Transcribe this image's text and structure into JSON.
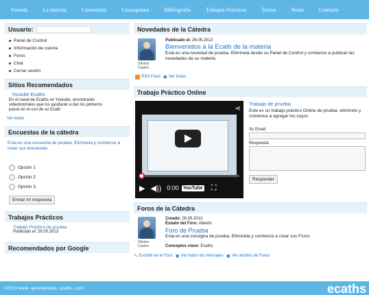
{
  "nav": {
    "items": [
      "Portada",
      "La materia",
      "Contenidos",
      "Cronograma",
      "Bibliografía",
      "Trabajos Prácticos",
      "Textos",
      "Notas",
      "Contacto"
    ]
  },
  "user": {
    "title": "Usuario:",
    "menu": [
      "Panel de Control",
      "Información de cuenta",
      "Foros",
      "Chat",
      "Cerrar sesión"
    ]
  },
  "recommended": {
    "title": "Sitios Recomendados",
    "item_title": "Youtube Ecaths",
    "item_desc": "En el canal de Ecaths en Youtube, encontrarán videotutoriales que los ayudarán a dar los primeros pasos en el uso de su Ecath",
    "more": "Ver todos"
  },
  "poll": {
    "title": "Encuestas de la cátedra",
    "question": "Esta es una encuesta de prueba. Elimínela y comience a crear sus encuestas",
    "options": [
      "Opción 1",
      "Opción 2",
      "Opción 3"
    ],
    "send": "Enviar mi respuesta"
  },
  "practicos": {
    "title": "Trabajos Prácticos",
    "item_title": "Trabajo Práctico de prueba",
    "item_date": "Publicado el: 26.05.2013"
  },
  "google": {
    "title": "Recomendados por Google"
  },
  "news": {
    "title": "Novedades de la Cátedra",
    "published_label": "Publicado el:",
    "published_date": "26.05.2013",
    "headline": "Bienvenidos a la Ecath de la materia",
    "text": "Esta es una novedad de prueba. Elimínela desde su Panel de Control y comience a publicar las novedades de su materia",
    "author": "Silvina Castro",
    "rss": "RSS Feed",
    "see_all": "Ver todas"
  },
  "tpo": {
    "title": "Trabajo Práctico Online",
    "video_time": "0:00",
    "video_logo": "YouTube",
    "progress": 0.03,
    "item_title": "Trabajo de prueba",
    "item_text": "Este es un trabajo práctico Online de prueba, elimínelo y comience a agregar los suyos",
    "email_label": "Su Email",
    "answer_label": "Respuesta",
    "submit": "Responder"
  },
  "forum": {
    "title": "Foros de la Cátedra",
    "created_label": "Creado:",
    "created_date": "26.05.2013",
    "state_label": "Estado del Foro:",
    "state": "Abierto",
    "headline": "Foro de Prueba",
    "text": "Esta es una consigna de prueba. Elimínela y comience a crear sus Foros",
    "tags_label": "Conceptos clave:",
    "tags": "Ecaths",
    "author": "Silvina Castro",
    "write": "Escribir en el Foro",
    "see_messages": "Ver todos los mensajes",
    "archive": "Ver archivo de Foros"
  },
  "footer": {
    "copyright": "©2013 www. aprendeiastic. ecaths. com",
    "brand_e": "e",
    "brand_rest": "caths"
  },
  "colors": {
    "accent": "#5eb6e4",
    "link": "#1a73c8",
    "box_header": "#e5f2fa"
  }
}
